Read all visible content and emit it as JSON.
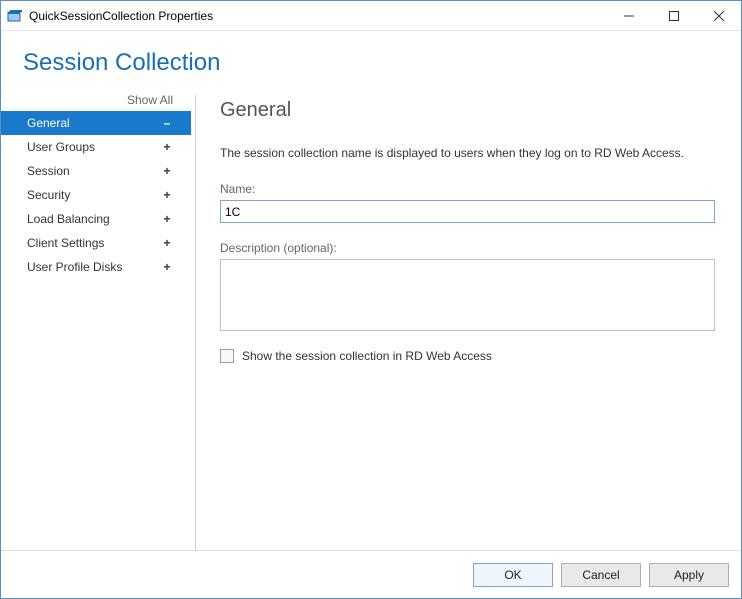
{
  "window": {
    "title": "QuickSessionCollection Properties"
  },
  "page": {
    "title": "Session Collection"
  },
  "sidebar": {
    "show_all": "Show All",
    "items": [
      {
        "label": "General",
        "expander": "–",
        "selected": true
      },
      {
        "label": "User Groups",
        "expander": "+",
        "selected": false
      },
      {
        "label": "Session",
        "expander": "+",
        "selected": false
      },
      {
        "label": "Security",
        "expander": "+",
        "selected": false
      },
      {
        "label": "Load Balancing",
        "expander": "+",
        "selected": false
      },
      {
        "label": "Client Settings",
        "expander": "+",
        "selected": false
      },
      {
        "label": "User Profile Disks",
        "expander": "+",
        "selected": false
      }
    ]
  },
  "main": {
    "heading": "General",
    "help": "The session collection name is displayed to users when they log on to RD Web Access.",
    "name_label": "Name:",
    "name_value": "1C",
    "desc_label": "Description (optional):",
    "desc_value": "",
    "checkbox_label": "Show the session collection in RD Web Access",
    "checkbox_checked": false
  },
  "footer": {
    "ok": "OK",
    "cancel": "Cancel",
    "apply": "Apply"
  }
}
